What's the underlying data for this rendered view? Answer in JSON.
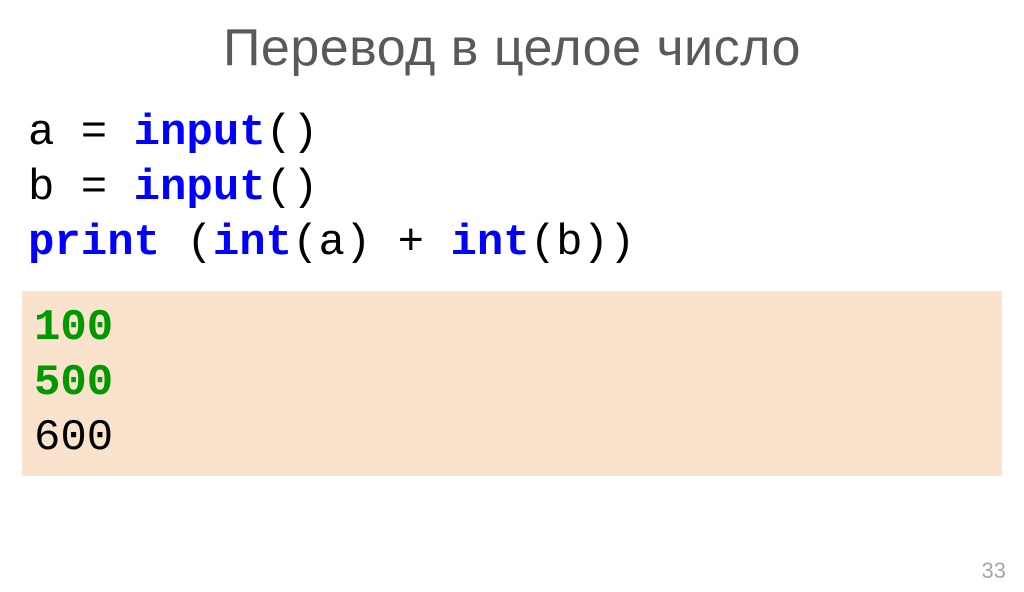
{
  "title": "Перевод в целое число",
  "code": {
    "line1": {
      "a": "a = ",
      "input": "input",
      "tail": "()"
    },
    "line2": {
      "b": "b = ",
      "input": "input",
      "tail": "()"
    },
    "line3": {
      "print": "print",
      "space": " (",
      "int1": "int",
      "mid1": "(a) + ",
      "int2": "int",
      "mid2": "(b))"
    }
  },
  "output": {
    "in1": "100",
    "in2": "500",
    "result": "600"
  },
  "page": "33"
}
